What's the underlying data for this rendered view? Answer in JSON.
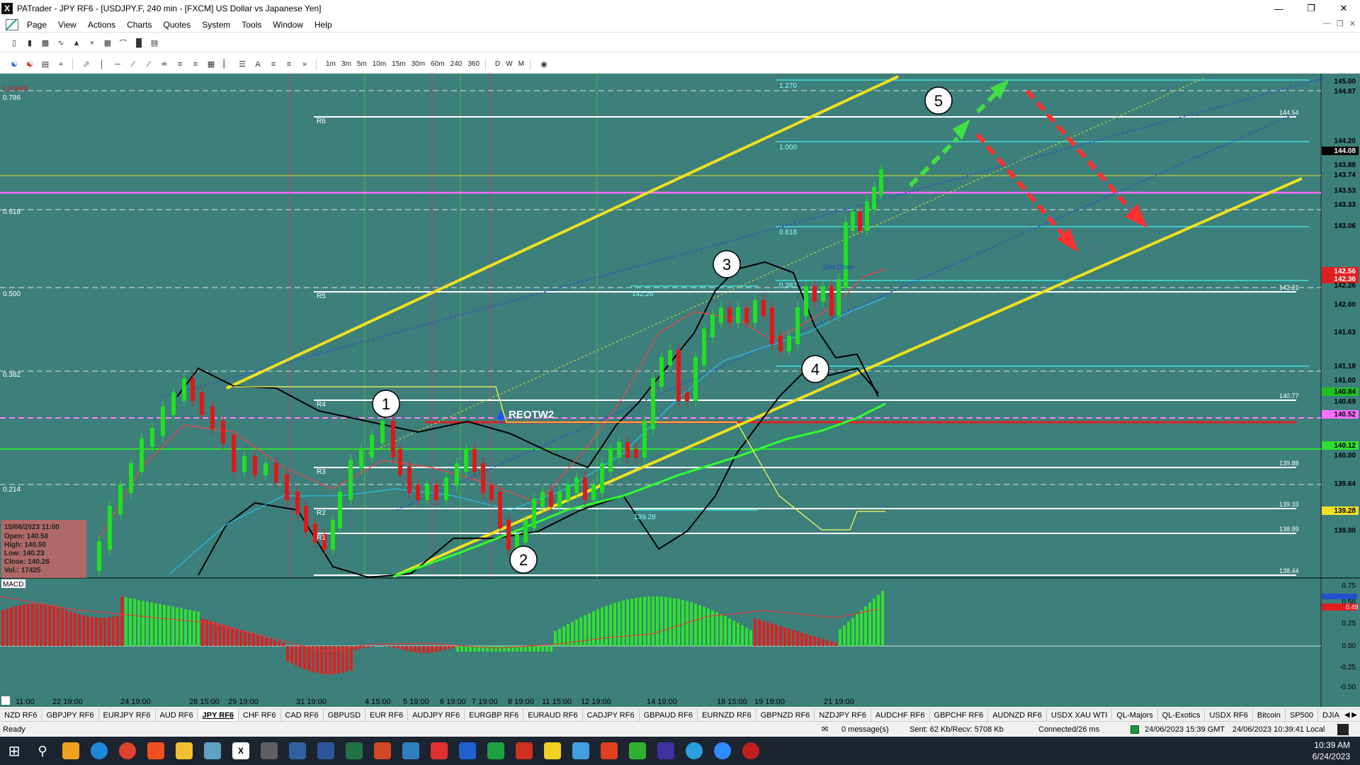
{
  "window": {
    "title": "PATrader - JPY RF6 - [USDJPY.F, 240 min - [FXCM] US Dollar vs Japanese Yen]",
    "app_icon": "X"
  },
  "menu": [
    "Page",
    "View",
    "Actions",
    "Charts",
    "Quotes",
    "System",
    "Tools",
    "Window",
    "Help"
  ],
  "timeframes": [
    "1m",
    "3m",
    "5m",
    "10m",
    "15m",
    "30m",
    "60m",
    "240",
    "360",
    "D",
    "W",
    "M"
  ],
  "chart": {
    "locked_label": "Locked",
    "fib_left": [
      "0.786",
      "0.618",
      "0.500",
      "0.382",
      "0.214"
    ],
    "fib_ext": [
      "1.270",
      "1.000",
      "0.618",
      "0.382"
    ],
    "pivot_labels": [
      "R6",
      "R5",
      "R4",
      "R3",
      "R2",
      "R1"
    ],
    "price_axis": [
      "145.00",
      "144.87",
      "144.20",
      "144.08",
      "143.88",
      "143.74",
      "143.53",
      "143.33",
      "143.06",
      "142.56",
      "142.36",
      "142.26",
      "142.00",
      "141.63",
      "141.18",
      "141.00",
      "140.84",
      "140.69",
      "140.52",
      "140.12",
      "140.00",
      "139.64",
      "139.28",
      "139.00"
    ],
    "right_labels": [
      "144.54",
      "142.21",
      "140.77",
      "139.88",
      "139.33",
      "138.99",
      "138.44"
    ],
    "wave_labels": [
      "1",
      "2",
      "3",
      "4",
      "5"
    ],
    "reotw_label": "REOTW2",
    "level_note_low": "139.28",
    "level_note_142": "142.26",
    "grid_close_label": "Grid Close",
    "ohlc": {
      "date": "15/06/2023 11:00",
      "open": "Open: 140.50",
      "high": "High: 140.50",
      "low": "Low: 140.23",
      "close": "Close: 140.26",
      "vol": "Vol.: 17425"
    },
    "macd_label": "MACD",
    "macd_axis": [
      "0.75",
      "0.50",
      "0.25",
      "0.00",
      "-0.25",
      "-0.50"
    ],
    "macd_values": [
      "0.49"
    ],
    "time_axis": [
      "11:00",
      "22 19:00",
      "24 19:00",
      "28 15:00",
      "29 19:00",
      "31 19:00",
      "4 15:00",
      "5 19:00",
      "6 19:00",
      "7 19:00",
      "8 19:00",
      "11 15:00",
      "12 19:00",
      "14 19:00",
      "18 15:00",
      "19 19:00",
      "21 19:00"
    ]
  },
  "tabs": [
    "NZD RF6",
    "GBPJPY RF6",
    "EURJPY RF6",
    "AUD RF6",
    "JPY RF6",
    "CHF RF6",
    "CAD RF6",
    "GBPUSD",
    "EUR RF6",
    "AUDJPY RF6",
    "EURGBP RF6",
    "EURAUD RF6",
    "CADJPY RF6",
    "GBPAUD RF6",
    "EURNZD RF6",
    "GBPNZD RF6",
    "NZDJPY RF6",
    "AUDCHF RF6",
    "GBPCHF RF6",
    "AUDNZD RF6",
    "USDX XAU WTI",
    "QL-Majors",
    "QL-Exotics",
    "USDX RF6",
    "Bitcoin",
    "SP500",
    "DJIA"
  ],
  "active_tab": "JPY RF6",
  "status": {
    "ready": "Ready",
    "messages": "0 message(s)",
    "sent": "Sent: 62 Kb/Recv: 5708 Kb",
    "connected": "Connected/26 ms",
    "gmt_time": "24/06/2023 15:39 GMT",
    "local_time": "24/06/2023 10:39:41 Local"
  },
  "clock": {
    "time": "10:39 AM",
    "date": "6/24/2023"
  },
  "colors": {
    "chart_bg": "#3d7f7b",
    "bull": "#20e020",
    "bear": "#e01818",
    "channel": "#f0e020",
    "taskbar": "#1c2430"
  }
}
